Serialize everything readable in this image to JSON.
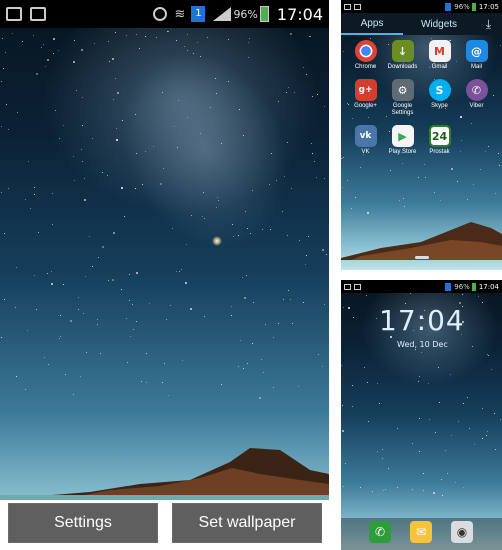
{
  "main": {
    "status_time": "17:04",
    "battery": "96%",
    "settings_label": "Settings",
    "set_wallpaper_label": "Set wallpaper"
  },
  "drawer": {
    "status_time": "17:05",
    "battery": "96%",
    "tabs": [
      {
        "label": "Apps"
      },
      {
        "label": "Widgets"
      }
    ],
    "apps": [
      {
        "label": "Chrome",
        "icon": "chrome-icon",
        "color": "#e8e8e8"
      },
      {
        "label": "Downloads",
        "icon": "download-icon",
        "color": "#6b8e23"
      },
      {
        "label": "Gmail",
        "icon": "gmail-icon",
        "color": "#f2f2f2"
      },
      {
        "label": "Mail",
        "icon": "mail-icon",
        "color": "#1e88e5"
      },
      {
        "label": "Google+",
        "icon": "googleplus-icon",
        "color": "#d23f31"
      },
      {
        "label": "Google Settings",
        "icon": "google-settings-icon",
        "color": "#5f6b73"
      },
      {
        "label": "Skype",
        "icon": "skype-icon",
        "color": "#00aff0"
      },
      {
        "label": "Viber",
        "icon": "viber-icon",
        "color": "#7b519d"
      },
      {
        "label": "VK",
        "icon": "vk-icon",
        "color": "#4a76a8"
      },
      {
        "label": "Play Store",
        "icon": "play-store-icon",
        "color": "#f5f5f5"
      },
      {
        "label": "Prostak",
        "icon": "prostak-icon",
        "color": "#ffffff"
      }
    ],
    "prostak_badge": "24"
  },
  "lock": {
    "status_time": "17:04",
    "battery": "96%",
    "clock": "17:04",
    "date": "Wed, 10 Dec"
  }
}
